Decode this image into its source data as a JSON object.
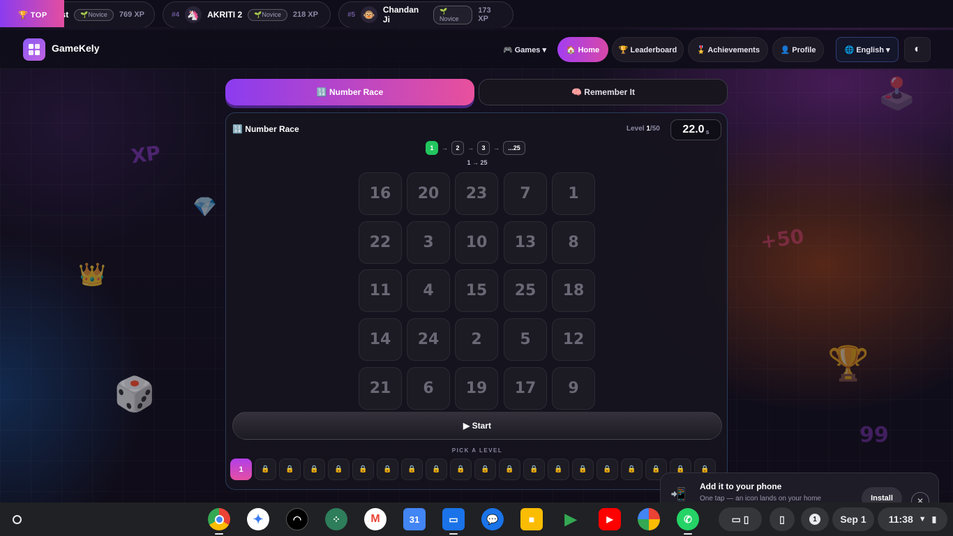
{
  "ticker": {
    "top_label": "🏆 TOP",
    "items": [
      {
        "rank": "",
        "name": "st",
        "badge": "🌱Novice",
        "xp": "769 XP",
        "avatar": ""
      },
      {
        "rank": "#4",
        "name": "AKRITI 2",
        "badge": "🌱Novice",
        "xp": "218 XP",
        "avatar": "🦄"
      },
      {
        "rank": "#5",
        "name": "Chandan Ji",
        "badge": "🌱Novice",
        "xp": "173 XP",
        "avatar": "🐵"
      }
    ]
  },
  "header": {
    "brand": "GameKely",
    "nav": {
      "games": "🎮 Games ▾",
      "home": "🏠 Home",
      "leaderboard": "🏆 Leaderboard",
      "achievements": "🎖️ Achievements",
      "profile": "👤 Profile",
      "language": "🌐 English ▾",
      "theme": "◐"
    }
  },
  "tabs": {
    "number_race": "🔢 Number Race",
    "remember_it": "🧠 Remember It"
  },
  "game": {
    "title": "🔢 Number Race",
    "level_prefix": "Level ",
    "level_current": "1",
    "level_total": "/50",
    "timer_value": "22.0",
    "timer_unit": "s",
    "sequence": [
      "1",
      "2",
      "3",
      "...25"
    ],
    "sequence_range": "1 → 25",
    "grid": [
      [
        "16",
        "20",
        "23",
        "7",
        "1"
      ],
      [
        "22",
        "3",
        "10",
        "13",
        "8"
      ],
      [
        "11",
        "4",
        "15",
        "25",
        "18"
      ],
      [
        "14",
        "24",
        "2",
        "5",
        "12"
      ],
      [
        "21",
        "6",
        "19",
        "17",
        "9"
      ]
    ],
    "start_label": "▶ Start",
    "pick_level_label": "PICK A LEVEL",
    "active_level": "1",
    "locked_icon": "🔒"
  },
  "decor": {
    "xp": "XP",
    "plus50": "+50",
    "n99": "99"
  },
  "install_toast": {
    "title": "Add it to your phone",
    "subtitle": "One tap — an icon lands on your home",
    "install_label": "Install",
    "close_label": "✕",
    "icon": "📲"
  },
  "shelf": {
    "apps": [
      {
        "name": "chrome-icon"
      },
      {
        "name": "gemini-icon"
      },
      {
        "name": "app-icon"
      },
      {
        "name": "apps-icon"
      },
      {
        "name": "gmail-icon"
      },
      {
        "name": "calendar-icon",
        "label": "31"
      },
      {
        "name": "files-icon"
      },
      {
        "name": "messages-icon"
      },
      {
        "name": "meet-icon"
      },
      {
        "name": "play-store-icon"
      },
      {
        "name": "youtube-icon"
      },
      {
        "name": "photos-icon"
      },
      {
        "name": "whatsapp-icon"
      }
    ],
    "notification_count": "1",
    "date": "Sep 1",
    "time": "11:38"
  }
}
